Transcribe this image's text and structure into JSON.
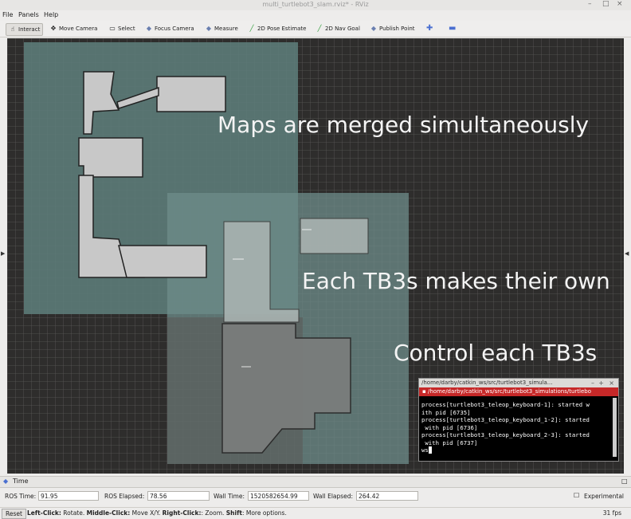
{
  "window": {
    "title": "multi_turtlebot3_slam.rviz* - RViz"
  },
  "menu": {
    "file": "File",
    "panels": "Panels",
    "help": "Help"
  },
  "toolbar": {
    "interact": "Interact",
    "move_camera": "Move Camera",
    "select": "Select",
    "focus_camera": "Focus Camera",
    "measure": "Measure",
    "pose_estimate": "2D Pose Estimate",
    "nav_goal": "2D Nav Goal",
    "publish_point": "Publish Point"
  },
  "overlay": {
    "maps_merged": "Maps are merged simultaneously",
    "each_makes": "Each TB3s makes their own",
    "control_each": "Control each TB3s"
  },
  "terminal": {
    "title": "/home/darby/catkin_ws/src/turtlebot3_simula...",
    "tab": "/home/darby/catkin_ws/src/turtlebot3_simulations/turtlebo",
    "lines": [
      "process[turtlebot3_teleop_keyboard-1]: started w",
      "ith pid [6735]",
      "process[turtlebot3_teleop_keyboard_1-2]: started",
      " with pid [6736]",
      "process[turtlebot3_teleop_keyboard_2-3]: started",
      " with pid [6737]",
      "ws"
    ]
  },
  "time_panel": {
    "title": "Time",
    "ros_time_label": "ROS Time:",
    "ros_time": "91.95",
    "ros_elapsed_label": "ROS Elapsed:",
    "ros_elapsed": "78.56",
    "wall_time_label": "Wall Time:",
    "wall_time": "1520582654.99",
    "wall_elapsed_label": "Wall Elapsed:",
    "wall_elapsed": "264.42",
    "experimental": "Experimental"
  },
  "status": {
    "reset": "Reset",
    "hint_left": "Left-Click:",
    "hint_left_text": " Rotate. ",
    "hint_middle": "Middle-Click:",
    "hint_middle_text": " Move X/Y. ",
    "hint_right": "Right-Click:",
    "hint_right_text": ": Zoom. ",
    "hint_shift": "Shift",
    "hint_shift_text": ": More options.",
    "fps": "31 fps"
  }
}
